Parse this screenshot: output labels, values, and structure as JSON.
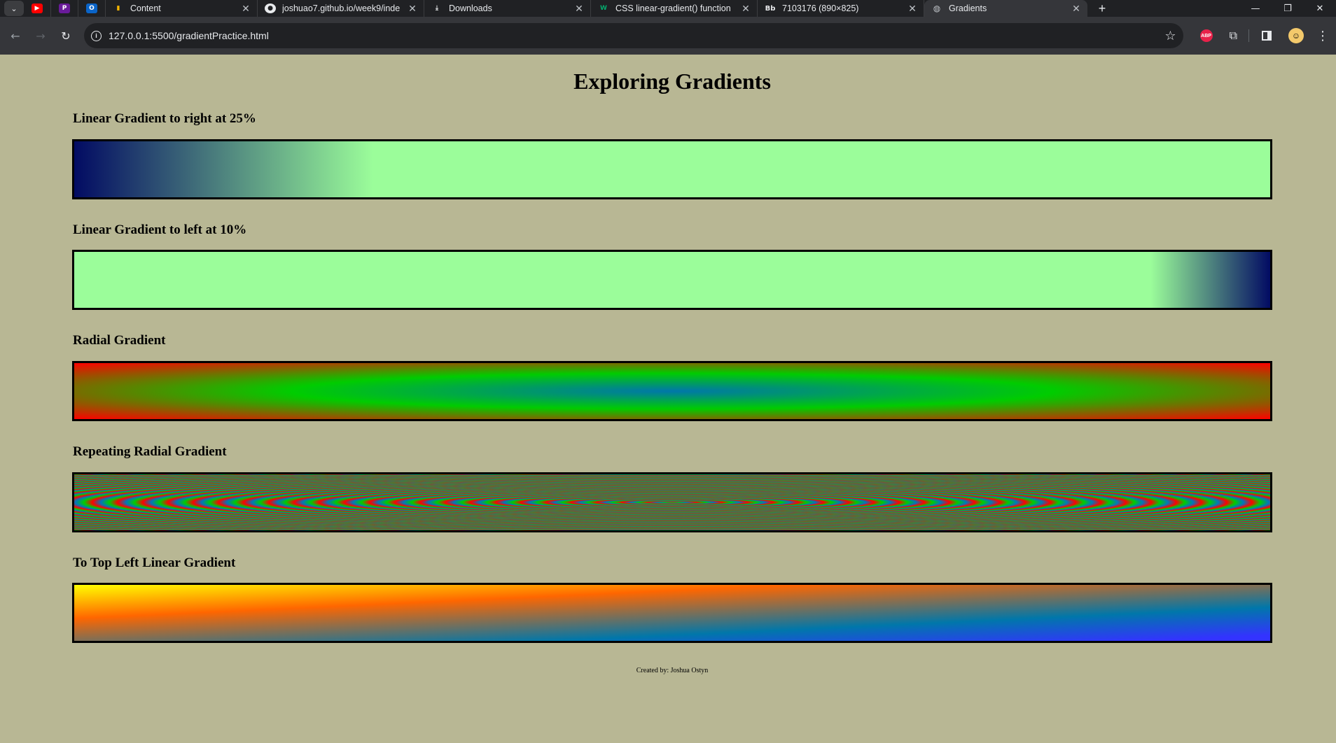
{
  "browser": {
    "tabs": [
      {
        "label": "Content",
        "icon": "chart-icon",
        "active": false
      },
      {
        "label": "joshuao7.github.io/week9/inde",
        "icon": "github-icon",
        "active": false
      },
      {
        "label": "Downloads",
        "icon": "download-icon",
        "active": false
      },
      {
        "label": "CSS linear-gradient() function",
        "icon": "w3schools-icon",
        "active": false
      },
      {
        "label": "7103176 (890×825)",
        "icon": "bb-icon",
        "active": false
      },
      {
        "label": "Gradients",
        "icon": "globe-icon",
        "active": true
      }
    ],
    "pinned_tabs": [
      "youtube-icon",
      "p-icon",
      "outlook-icon"
    ],
    "url": "127.0.0.1:5500/gradientPractice.html",
    "abp_label": "ABP"
  },
  "page": {
    "title": "Exploring Gradients",
    "sections": [
      {
        "title": "Linear Gradient to right at 25%",
        "colors": [
          "#020b63",
          "#9bfd9a"
        ]
      },
      {
        "title": "Linear Gradient to left at 10%",
        "colors": [
          "#020b63",
          "#9bfd9a"
        ]
      },
      {
        "title": "Radial Gradient",
        "colors": [
          "#0077aa",
          "#00cc00",
          "#ff0000"
        ]
      },
      {
        "title": "Repeating Radial Gradient",
        "colors": [
          "#ff0000",
          "#00cc00",
          "#0077bb"
        ]
      },
      {
        "title": "To Top Left Linear Gradient",
        "colors": [
          "#3333ff",
          "#0077aa",
          "#ff6600",
          "#ffff00"
        ]
      }
    ],
    "footer": "Created by: Joshua Ostyn",
    "background": "#b8b794"
  }
}
